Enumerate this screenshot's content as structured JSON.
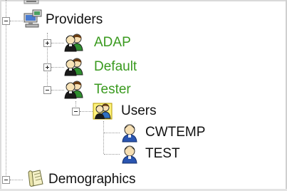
{
  "tree": {
    "nodes": [
      {
        "id": "providers",
        "label": "Providers",
        "color": "#111111",
        "icon": "computer-network-icon",
        "expanded": true
      },
      {
        "id": "adap",
        "label": "ADAP",
        "color": "#3a9a1f",
        "icon": "user-group-icon",
        "expanded": false
      },
      {
        "id": "default",
        "label": "Default",
        "color": "#3a9a1f",
        "icon": "user-group-icon",
        "expanded": false
      },
      {
        "id": "tester",
        "label": "Tester",
        "color": "#3a9a1f",
        "icon": "user-group-icon",
        "expanded": true
      },
      {
        "id": "users",
        "label": "Users",
        "color": "#111111",
        "icon": "users-folder-icon",
        "expanded": true
      },
      {
        "id": "cwtemp",
        "label": "CWTEMP",
        "color": "#111111",
        "icon": "user-icon"
      },
      {
        "id": "test",
        "label": "TEST",
        "color": "#111111",
        "icon": "user-icon"
      },
      {
        "id": "demographics",
        "label": "Demographics",
        "color": "#111111",
        "icon": "scroll-document-icon",
        "expanded": true
      }
    ]
  }
}
